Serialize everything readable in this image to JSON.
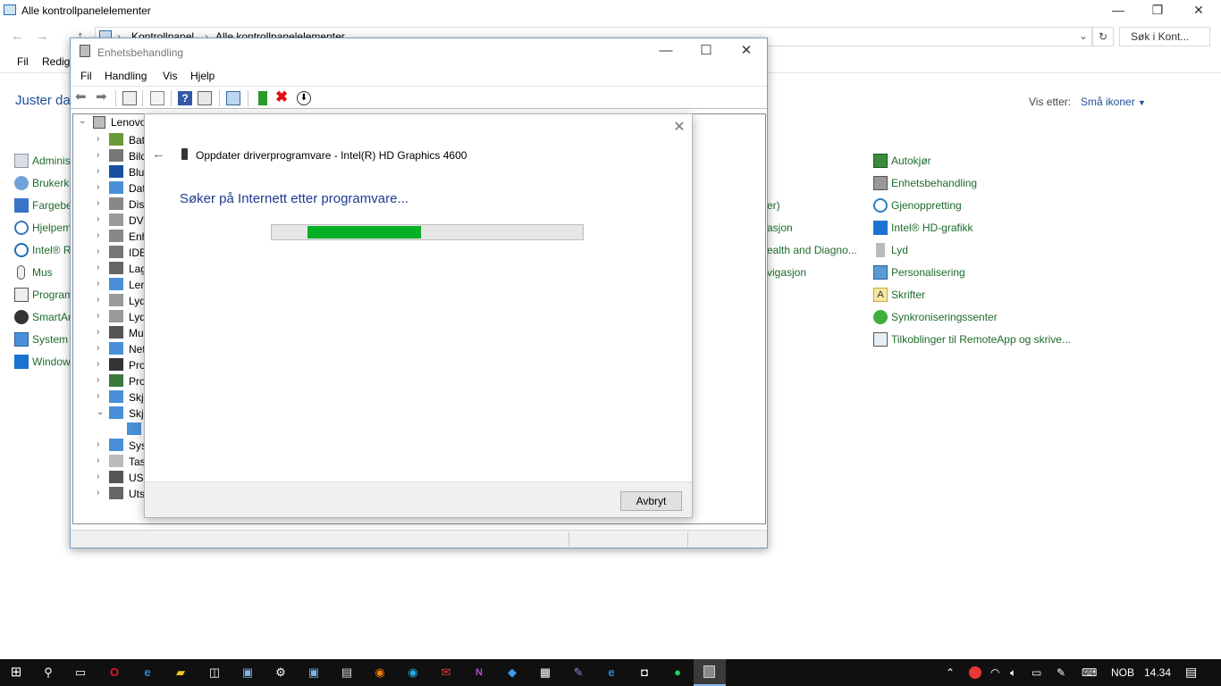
{
  "cp": {
    "title": "Alle kontrollpanelelementer",
    "breadcrumb": [
      "Kontrollpanel",
      "Alle kontrollpanelelementer"
    ],
    "search_placeholder": "Søk i Kont...",
    "menu": [
      "Fil",
      "Redig"
    ],
    "heading": "Juster da",
    "view_by_label": "Vis etter:",
    "view_by_value": "Små ikoner",
    "col1": [
      "Adminis",
      "Brukerk",
      "Fargebe",
      "Hjelpem",
      "Intel® R",
      "Mus",
      "Program",
      "SmartAu",
      "System",
      "Window"
    ],
    "col2": [
      "er)",
      "asjon",
      "ealth and Diagno...",
      "vigasjon"
    ],
    "col3": [
      "Autokjør",
      "Enhetsbehandling",
      "Gjenoppretting",
      "Intel® HD-grafikk",
      "Lyd",
      "Personalisering",
      "Skrifter",
      "Synkroniseringssenter",
      "Tilkoblinger til RemoteApp og skrive..."
    ]
  },
  "dm": {
    "title": "Enhetsbehandling",
    "menu": [
      "Fil",
      "Handling",
      "Vis",
      "Hjelp"
    ],
    "root": "Lenovo",
    "tree": [
      "Batt",
      "Bild",
      "Blue",
      "Dat",
      "Disk",
      "DVD",
      "Enh",
      "IDE",
      "Lag",
      "Len",
      "Lyd",
      "Lyd",
      "Mu",
      "Net",
      "Pro",
      "Pro",
      "Skje",
      "Skje",
      "",
      "Syst",
      "Tast",
      "USB",
      "Utst"
    ]
  },
  "dialog": {
    "title": "Oppdater driverprogramvare - Intel(R) HD Graphics 4600",
    "status": "Søker på Internett etter programvare...",
    "progress_start": 0.115,
    "progress_end": 0.48,
    "cancel": "Avbryt"
  },
  "taskbar": {
    "language": "NOB",
    "time": "14.34"
  }
}
